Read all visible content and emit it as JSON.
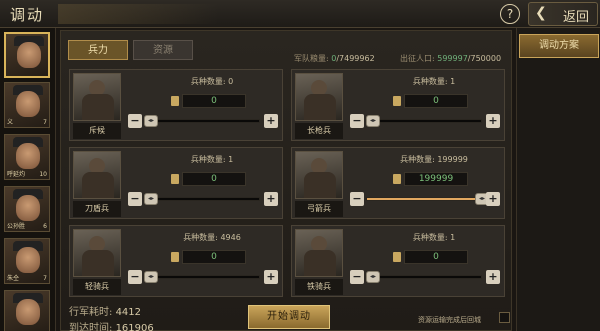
{
  "header": {
    "title": "调动",
    "back_label": "返回",
    "help_icon": "?"
  },
  "sidebar": {
    "generals": [
      {
        "name": "",
        "count": ""
      },
      {
        "name": "义",
        "count": "7"
      },
      {
        "name": "呼延灼",
        "count": "10"
      },
      {
        "name": "公孙胜",
        "count": "6"
      },
      {
        "name": "朱仝",
        "count": "7"
      },
      {
        "name": "",
        "count": ""
      }
    ]
  },
  "tabs": {
    "troops": "兵力",
    "resources": "资源"
  },
  "stats": {
    "food_label": "军队粮量: ",
    "food_used": "0",
    "food_total": "/7499962",
    "pop_label": "出征人口: ",
    "pop_used": "599997",
    "pop_total": "/750000"
  },
  "units": [
    {
      "name": "斥候",
      "count_label": "兵种数量: ",
      "count": "0",
      "value": "0",
      "fill": 0
    },
    {
      "name": "长枪兵",
      "count_label": "兵种数量: ",
      "count": "1",
      "value": "0",
      "fill": 0
    },
    {
      "name": "刀盾兵",
      "count_label": "兵种数量: ",
      "count": "1",
      "value": "0",
      "fill": 0
    },
    {
      "name": "弓箭兵",
      "count_label": "兵种数量: ",
      "count": "199999",
      "value": "199999",
      "fill": 1
    },
    {
      "name": "轻骑兵",
      "count_label": "兵种数量: ",
      "count": "4946",
      "value": "0",
      "fill": 0
    },
    {
      "name": "铁骑兵",
      "count_label": "兵种数量: ",
      "count": "1",
      "value": "0",
      "fill": 0
    }
  ],
  "footer": {
    "march_label": "行军耗时: ",
    "march_value": "4412",
    "arrive_label": "到达时间: ",
    "arrive_value": "161906",
    "start_button": "开始调动",
    "auto_return": "资源运输完成后回城"
  },
  "right": {
    "plan_button": "调动方案"
  },
  "colors": {
    "accent": "#c9a45a",
    "green": "#7cc07a",
    "slider_fill": "#e2a860"
  }
}
